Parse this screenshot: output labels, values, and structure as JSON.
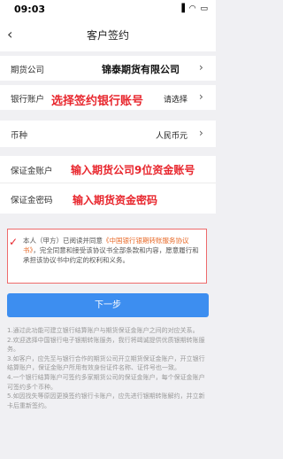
{
  "status_bar": {
    "time": "09:03",
    "icons": "▐ ◠ ▭"
  },
  "nav": {
    "back_icon": "‹",
    "title": "客户签约"
  },
  "form": {
    "futures_company": {
      "label": "期货公司",
      "value": "锦泰期货有限公司"
    },
    "bank_account": {
      "label": "银行账户",
      "value": "请选择"
    },
    "currency": {
      "label": "币种",
      "value": "人民币元"
    },
    "margin_account": {
      "label": "保证金账户"
    },
    "margin_password": {
      "label": "保证金密码"
    }
  },
  "annotations": {
    "bank": "选择签约银行账号",
    "margin_account": "输入期货公司9位资金账号",
    "margin_password": "输入期货资金密码"
  },
  "terms": {
    "check": "✓",
    "prefix": "本人（甲方）已阅读并同意",
    "link": "《中国银行银期转账服务协议书》",
    "suffix": "，完全同意和接受该协议书全部条款和内容，愿意履行和承担该协议书中约定的权利和义务。"
  },
  "submit": {
    "label": "下一步"
  },
  "notes": [
    "1.通过此功能可建立银行结算账户与期货保证金账户之间的对应关系。",
    "2.欢迎选择中国银行电子银期转账服务，我行将竭诚提供优质银期转账服务。",
    "3.如客户，应先至与银行合作的期货公司开立期货保证金账户，开立银行结算账户，保证金账户所用有效身份证件名称、证件号也一致。",
    "4.一个银行结算账户可签约多家期货公司的保证金账户，每个保证金账户可签约多个币种。",
    "5.如因找失等原因更换签约银行卡账户，应先进行银期转账解约，并立新卡后重新签约。"
  ]
}
